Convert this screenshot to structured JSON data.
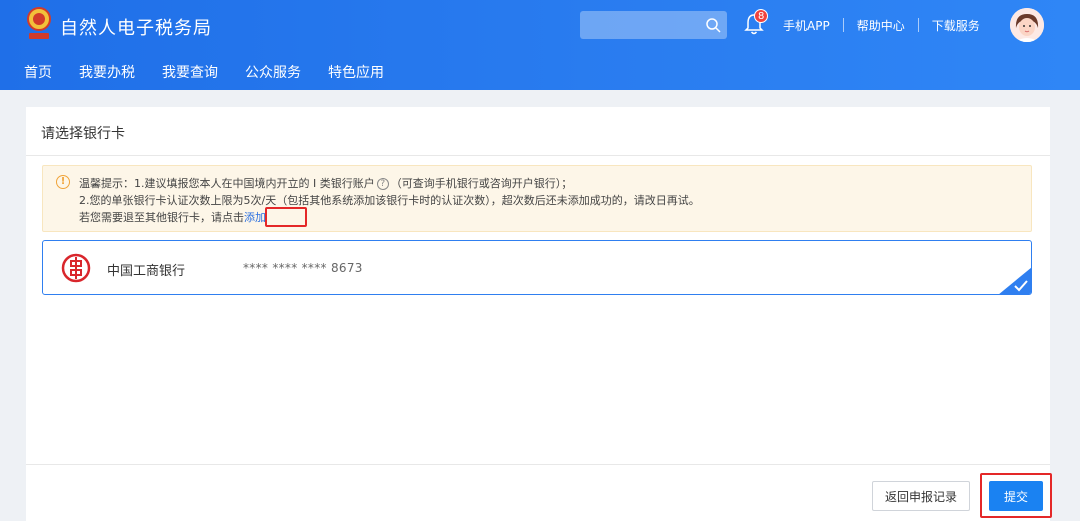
{
  "header": {
    "site_title": "自然人电子税务局",
    "search_placeholder": "",
    "notification_count": "8",
    "links": [
      "手机APP",
      "帮助中心",
      "下载服务"
    ]
  },
  "nav": {
    "items": [
      "首页",
      "我要办税",
      "我要查询",
      "公众服务",
      "特色应用"
    ]
  },
  "panel": {
    "title": "请选择银行卡",
    "notice": {
      "line1_text": "温馨提示：1.建议填报您本人在中国境内开立的 Ⅰ 类银行账户",
      "line1_hint": "（可查询手机银行或咨询开户银行）；",
      "line2_text": "2.您的单张银行卡认证次数上限为5次/天（包括其他系统添加该银行卡时的认证次数），超次数后还未添加成功的，请改日再试。",
      "line3_text": "若您需要退至其他银行卡，请点击",
      "add_link": "添加"
    },
    "card": {
      "bank_name": "中国工商银行",
      "card_number": "**** **** **** 8673",
      "selected": true
    },
    "buttons": {
      "back_label": "返回申报记录",
      "submit_label": "提交"
    }
  },
  "colors": {
    "header_blue": "#2a7df0",
    "link_blue": "#2a6fe0",
    "highlight_red": "#e42828",
    "notice_bg": "#fdf6e8",
    "submit_blue": "#1a82f2"
  },
  "icons": [
    "emblem-icon",
    "search-icon",
    "bell-icon",
    "avatar",
    "warning-icon",
    "help-circle-icon",
    "icbc-logo-icon",
    "checkmark-icon"
  ]
}
